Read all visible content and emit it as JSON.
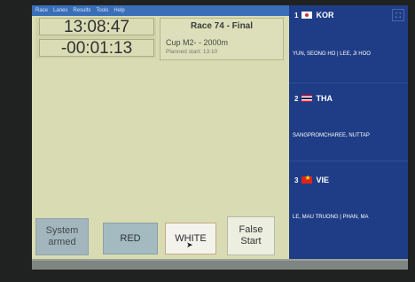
{
  "app": {
    "menu": [
      "Race",
      "Lanes",
      "Results",
      "Tools",
      "Help"
    ]
  },
  "clock": {
    "time": "13:08:47",
    "countdown": "-00:01:13"
  },
  "race": {
    "title": "Race 74 - Final",
    "subtitle": "Cup M2-  - 2000m",
    "planned": "Planned start: 13:10"
  },
  "lanes": [
    {
      "number": "1",
      "code": "KOR",
      "flag": "kor-flag-icon",
      "names": "YUN, SEONG HO | LEE, JI HOO"
    },
    {
      "number": "2",
      "code": "THA",
      "flag": "tha-flag-icon",
      "names": "SANGPROMCHAREE, NUTTAP"
    },
    {
      "number": "3",
      "code": "VIE",
      "flag": "vie-flag-icon",
      "names": "LE, MAU TRUONG | PHAN, MA"
    }
  ],
  "buttons": {
    "system": "System armed",
    "red": "RED",
    "white": "WHITE",
    "false_start": "False Start"
  },
  "icons": {
    "corner": "expand-icon",
    "cursor": "mouse-pointer-icon"
  },
  "colors": {
    "lanes_bg": "#1f3d86",
    "panel_bg": "#d9dcb3"
  }
}
